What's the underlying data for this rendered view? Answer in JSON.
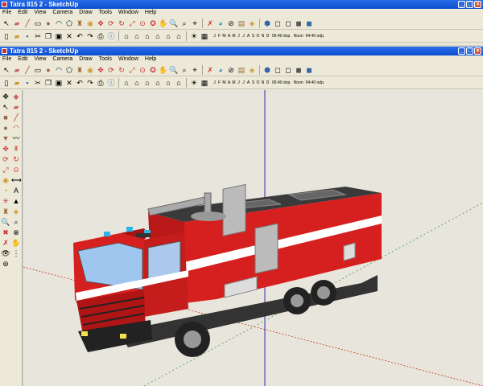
{
  "app": {
    "window_title": "Tatra 815 2 - SketchUp",
    "second_window_title": "Tatra 815 2 - SketchUp"
  },
  "menu": [
    "File",
    "Edit",
    "View",
    "Camera",
    "Draw",
    "Tools",
    "Window",
    "Help"
  ],
  "shadow": {
    "months": [
      "J",
      "F",
      "M",
      "A",
      "M",
      "J",
      "J",
      "A",
      "S",
      "O",
      "N",
      "D"
    ],
    "time_start": "06:40 dop.",
    "time_mid": "Noon",
    "time_end": "04:40 odp."
  },
  "colors": {
    "titlebar": "#0b4fd1",
    "truck_red": "#d61f1f",
    "axis_red": "#c54",
    "axis_green": "#6a6",
    "axis_blue": "#33a"
  },
  "icons_toolbar1": [
    "select-icon",
    "eraser-icon",
    "paint-icon",
    "pencil-icon",
    "rectangle-icon",
    "circle-icon",
    "arc-icon",
    "polygon-icon",
    "freehand-icon",
    "move-icon",
    "pushpull-icon",
    "rotate-icon",
    "followme-icon",
    "scale-icon",
    "offset-icon",
    "tape-icon",
    "dimension-icon",
    "protractor-icon",
    "text-icon",
    "axes-icon",
    "3dtext-icon",
    "orbit-icon",
    "pan-icon",
    "zoom-icon",
    "zoomwindow-icon",
    "zoomextents-icon",
    "walk-icon",
    "position-camera-icon",
    "lookaround-icon",
    "section-icon"
  ],
  "icons_toolbar2": [
    "new-icon",
    "open-icon",
    "save-icon",
    "cut-icon",
    "copy-icon",
    "paste-icon",
    "erase-icon",
    "undo-icon",
    "redo-icon",
    "print-icon",
    "model-info-icon",
    "iso-view-icon",
    "top-view-icon",
    "front-view-icon",
    "right-view-icon",
    "back-view-icon",
    "left-view-icon",
    "xray-icon",
    "wireframe-icon",
    "hidden-line-icon",
    "shaded-icon",
    "textured-icon",
    "monochrome-icon"
  ]
}
